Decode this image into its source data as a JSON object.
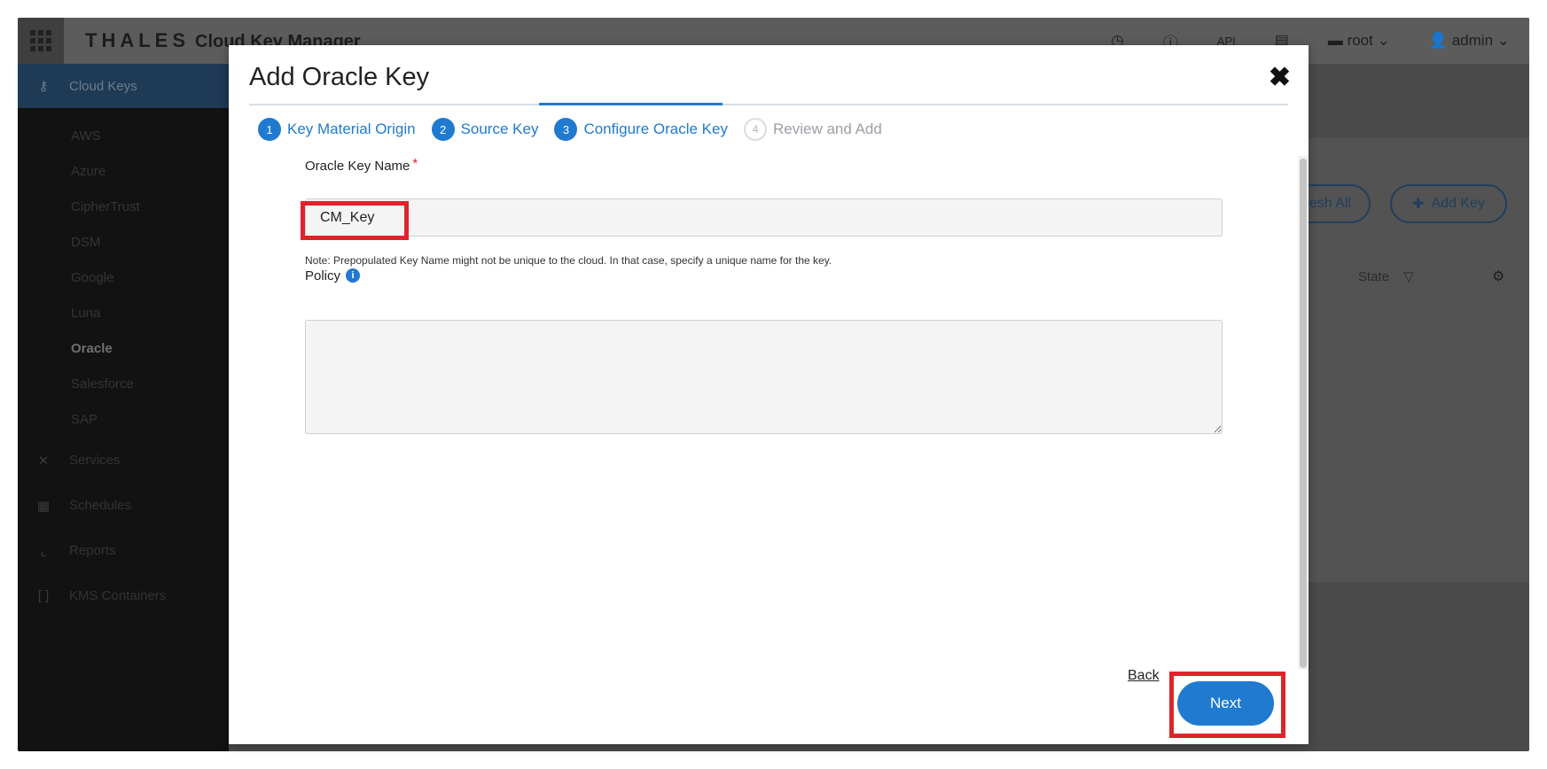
{
  "app": {
    "brand": "THALES",
    "product": "Cloud Key Manager",
    "topbar": {
      "api_label": "API",
      "domain_label": "root",
      "user_label": "admin"
    },
    "sidebar": {
      "section_title": "Cloud Keys",
      "items": [
        "AWS",
        "Azure",
        "CipherTrust",
        "DSM",
        "Google",
        "Luna",
        "Oracle",
        "Salesforce",
        "SAP"
      ],
      "active_item": "Oracle",
      "sections": [
        "Services",
        "Schedules",
        "Reports",
        "KMS Containers"
      ]
    },
    "background": {
      "refresh_all_label": "Refresh All",
      "add_key_label": "Add Key",
      "state_column": "State"
    }
  },
  "modal": {
    "title": "Add Oracle Key",
    "steps": [
      {
        "number": "1",
        "label": "Key Material Origin",
        "status": "done"
      },
      {
        "number": "2",
        "label": "Source Key",
        "status": "done"
      },
      {
        "number": "3",
        "label": "Configure Oracle Key",
        "status": "active"
      },
      {
        "number": "4",
        "label": "Review and Add",
        "status": "pending"
      }
    ],
    "key_name": {
      "label": "Oracle Key Name",
      "required_mark": "*",
      "value": "CM_Key"
    },
    "note": "Note: Prepopulated Key Name might not be unique to the cloud. In that case, specify a unique name for the key.",
    "policy": {
      "label": "Policy",
      "value": ""
    },
    "back_label": "Back",
    "next_label": "Next"
  },
  "colors": {
    "accent": "#1f7ad0",
    "highlight": "#e0232b"
  }
}
